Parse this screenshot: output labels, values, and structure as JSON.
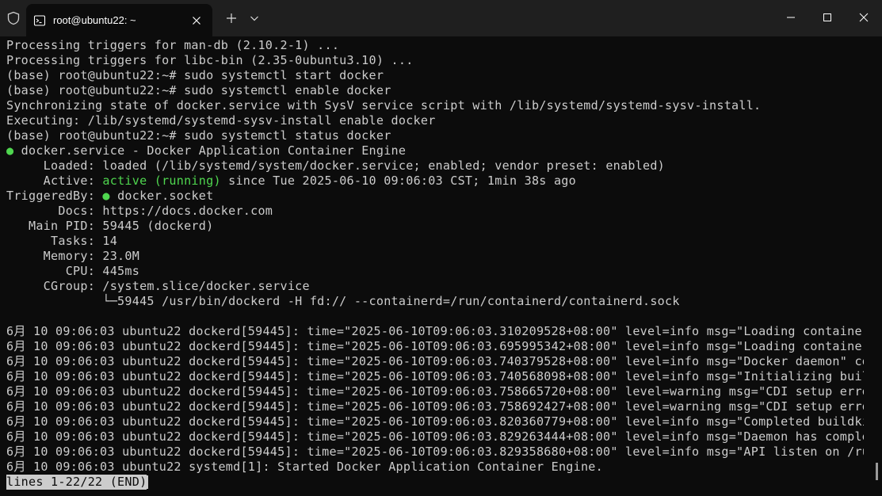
{
  "window": {
    "tab_title": "root@ubuntu22: ~"
  },
  "terminal": {
    "lines": [
      "Processing triggers for man-db (2.10.2-1) ...",
      "Processing triggers for libc-bin (2.35-0ubuntu3.10) ...",
      "(base) root@ubuntu22:~# sudo systemctl start docker",
      "(base) root@ubuntu22:~# sudo systemctl enable docker",
      "Synchronizing state of docker.service with SysV service script with /lib/systemd/systemd-sysv-install.",
      "Executing: /lib/systemd/systemd-sysv-install enable docker",
      "(base) root@ubuntu22:~# sudo systemctl status docker"
    ],
    "status": {
      "dot": "●",
      "service_line": " docker.service - Docker Application Container Engine",
      "loaded": "     Loaded: loaded (/lib/systemd/system/docker.service; enabled; vendor preset: enabled)",
      "active_prefix": "     Active: ",
      "active_state": "active (running)",
      "active_suffix": " since Tue 2025-06-10 09:06:03 CST; 1min 38s ago",
      "triggered_prefix": "TriggeredBy: ",
      "triggered_suffix": " docker.socket",
      "docs": "       Docs: https://docs.docker.com",
      "main_pid": "   Main PID: 59445 (dockerd)",
      "tasks": "      Tasks: 14",
      "memory": "     Memory: 23.0M",
      "cpu": "        CPU: 445ms",
      "cgroup": "     CGroup: /system.slice/docker.service",
      "cgroup_child": "             └─59445 /usr/bin/dockerd -H fd:// --containerd=/run/containerd/containerd.sock"
    },
    "logs": [
      "6月 10 09:06:03 ubuntu22 dockerd[59445]: time=\"2025-06-10T09:06:03.310209528+08:00\" level=info msg=\"Loading containers:",
      "6月 10 09:06:03 ubuntu22 dockerd[59445]: time=\"2025-06-10T09:06:03.695995342+08:00\" level=info msg=\"Loading containers:",
      "6月 10 09:06:03 ubuntu22 dockerd[59445]: time=\"2025-06-10T09:06:03.740379528+08:00\" level=info msg=\"Docker daemon\" comm",
      "6月 10 09:06:03 ubuntu22 dockerd[59445]: time=\"2025-06-10T09:06:03.740568098+08:00\" level=info msg=\"Initializing buildk",
      "6月 10 09:06:03 ubuntu22 dockerd[59445]: time=\"2025-06-10T09:06:03.758665720+08:00\" level=warning msg=\"CDI setup error ",
      "6月 10 09:06:03 ubuntu22 dockerd[59445]: time=\"2025-06-10T09:06:03.758692427+08:00\" level=warning msg=\"CDI setup error ",
      "6月 10 09:06:03 ubuntu22 dockerd[59445]: time=\"2025-06-10T09:06:03.820360779+08:00\" level=info msg=\"Completed buildkit ",
      "6月 10 09:06:03 ubuntu22 dockerd[59445]: time=\"2025-06-10T09:06:03.829263444+08:00\" level=info msg=\"Daemon has complete",
      "6月 10 09:06:03 ubuntu22 dockerd[59445]: time=\"2025-06-10T09:06:03.829358680+08:00\" level=info msg=\"API listen on /run/"
    ],
    "overflow_marker": ">",
    "last_line": "6月 10 09:06:03 ubuntu22 systemd[1]: Started Docker Application Container Engine.",
    "pager": "lines 1-22/22 (END)"
  }
}
